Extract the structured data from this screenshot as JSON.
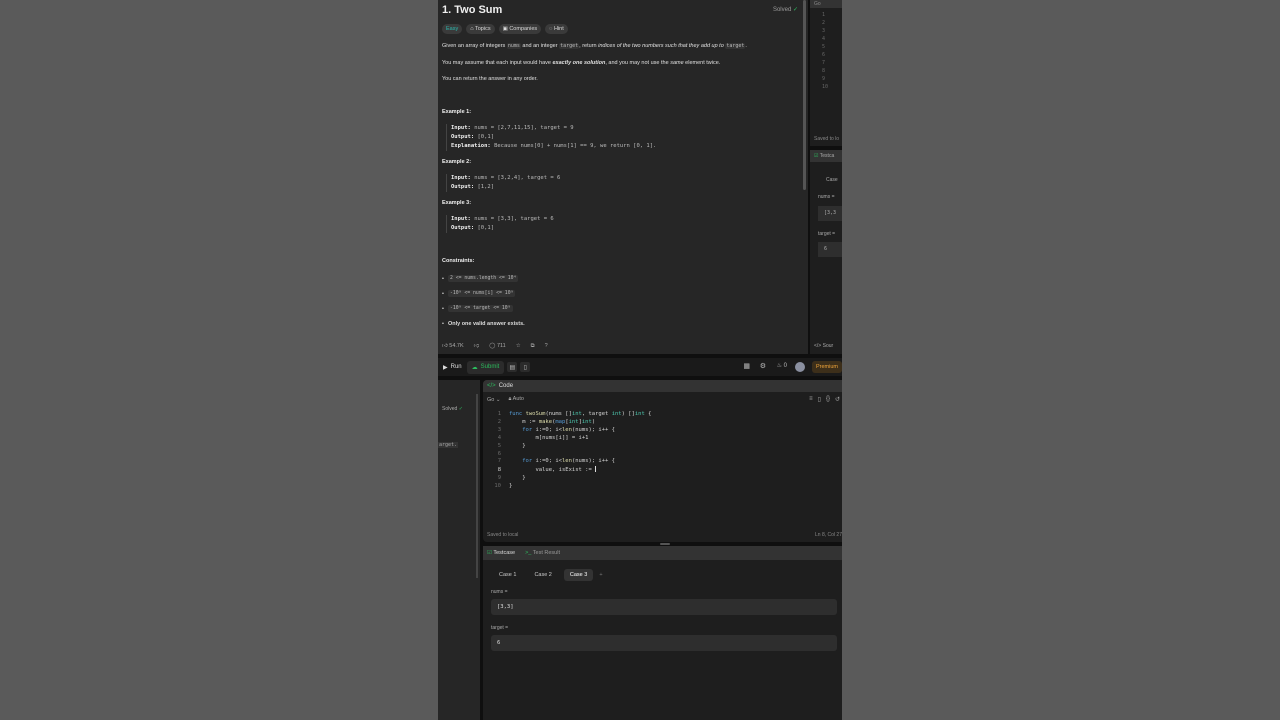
{
  "problem": {
    "title": "1. Two Sum",
    "status": "Solved",
    "difficulty": "Easy",
    "tags": [
      "Topics",
      "Companies",
      "Hint"
    ],
    "desc": {
      "p1a": "Given an array of integers ",
      "p1code1": "nums",
      "p1b": " and an integer ",
      "p1code2": "target",
      "p1c": ", return ",
      "p1em": "indices of the two numbers such that they add up to",
      "p1code3": "target",
      "p1end": ".",
      "p2a": "You may assume that each input would have ",
      "p2em": "exactly one solution",
      "p2b": ", and you may not use the ",
      "p2em2": "same",
      "p2c": " element twice.",
      "p3": "You can return the answer in any order."
    },
    "examples": [
      {
        "title": "Example 1:",
        "input": "nums = [2,7,11,15], target = 9",
        "output": "[0,1]",
        "explanation": "Because nums[0] + nums[1] == 9, we return [0, 1]."
      },
      {
        "title": "Example 2:",
        "input": "nums = [3,2,4], target = 6",
        "output": "[1,2]"
      },
      {
        "title": "Example 3:",
        "input": "nums = [3,3], target = 6",
        "output": "[0,1]"
      }
    ],
    "labels": {
      "input": "Input:",
      "output": "Output:",
      "explanation": "Explanation:",
      "constraints": "Constraints:"
    },
    "constraints": [
      "2 <= nums.length <= 10⁴",
      "-10⁹ <= nums[i] <= 10⁹",
      "-10⁹ <= target <= 10⁹"
    ],
    "constraint_last": "Only one valid answer exists.",
    "likes": "54.7K",
    "comments": "711"
  },
  "right_stub": {
    "lang": "Go",
    "saved": "Saved to lo",
    "tab": "Testca",
    "case": "Case",
    "nums_label": "nums =",
    "nums_val": "[3,3",
    "target_label": "target =",
    "target_val": "6",
    "source": "Sour"
  },
  "toolbar": {
    "run": "Run",
    "submit": "Submit",
    "streak": "0",
    "premium": "Premium"
  },
  "left_strip": {
    "solved": "Solved",
    "target_frag": "arget."
  },
  "editor": {
    "tab": "Code",
    "lang": "Go",
    "mode": "Auto",
    "saved": "Saved to local",
    "cursor": "Ln 8, Col 27"
  },
  "testcase": {
    "tab": "Testcase",
    "result_tab": "Test Result",
    "cases": [
      "Case 1",
      "Case 2",
      "Case 3"
    ],
    "active_case": "Case 3",
    "nums_label": "nums =",
    "nums_value": "[3,3]",
    "target_label": "target =",
    "target_value": "6"
  },
  "colors": {
    "accent_green": "#2cbb5d",
    "easy_teal": "#2cbbb0",
    "premium_orange": "#f0a53a"
  }
}
